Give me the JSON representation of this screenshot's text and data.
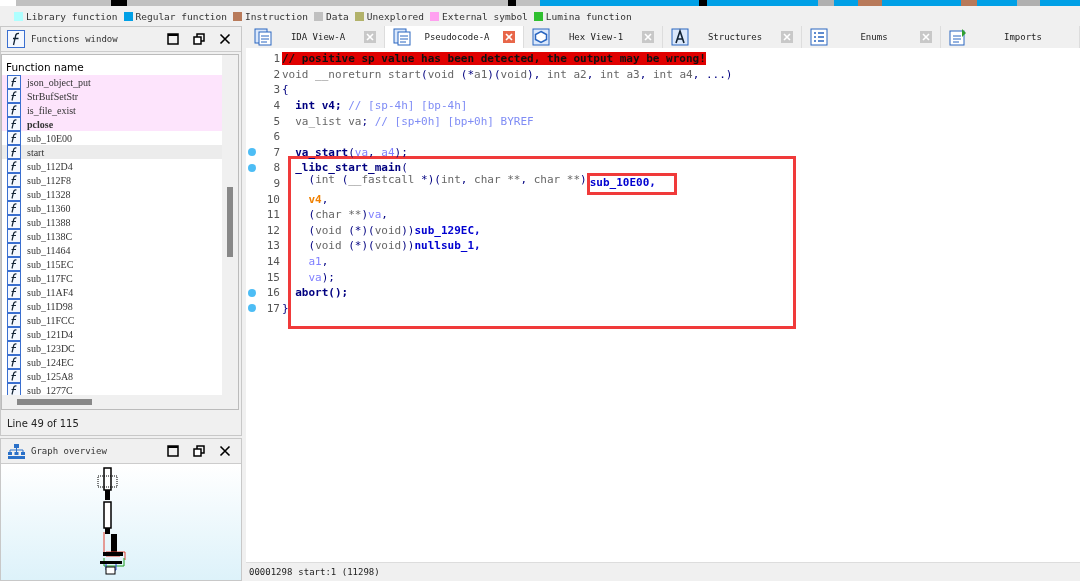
{
  "legend": [
    {
      "label": "Library function",
      "color": "#aeffff"
    },
    {
      "label": "Regular function",
      "color": "#00a0e6"
    },
    {
      "label": "Instruction",
      "color": "#b87a5a"
    },
    {
      "label": "Data",
      "color": "#c0c0c0"
    },
    {
      "label": "Unexplored",
      "color": "#b2b26a"
    },
    {
      "label": "External symbol",
      "color": "#ffa0f0"
    },
    {
      "label": "Lumina function",
      "color": "#30c030"
    }
  ],
  "functions_window": {
    "title": "Functions window",
    "column": "Function name",
    "items": [
      {
        "name": "json_object_put",
        "imported": true,
        "bold": false,
        "selected": false
      },
      {
        "name": "StrBufSetStr",
        "imported": true,
        "bold": false,
        "selected": false
      },
      {
        "name": "is_file_exist",
        "imported": true,
        "bold": false,
        "selected": false
      },
      {
        "name": "pclose",
        "imported": true,
        "bold": true,
        "selected": false
      },
      {
        "name": "sub_10E00",
        "imported": false,
        "bold": false,
        "selected": false
      },
      {
        "name": "start",
        "imported": false,
        "bold": false,
        "selected": true
      },
      {
        "name": "sub_112D4",
        "imported": false,
        "bold": false,
        "selected": false
      },
      {
        "name": "sub_112F8",
        "imported": false,
        "bold": false,
        "selected": false
      },
      {
        "name": "sub_11328",
        "imported": false,
        "bold": false,
        "selected": false
      },
      {
        "name": "sub_11360",
        "imported": false,
        "bold": false,
        "selected": false
      },
      {
        "name": "sub_11388",
        "imported": false,
        "bold": false,
        "selected": false
      },
      {
        "name": "sub_1138C",
        "imported": false,
        "bold": false,
        "selected": false
      },
      {
        "name": "sub_11464",
        "imported": false,
        "bold": false,
        "selected": false
      },
      {
        "name": "sub_115EC",
        "imported": false,
        "bold": false,
        "selected": false
      },
      {
        "name": "sub_117FC",
        "imported": false,
        "bold": false,
        "selected": false
      },
      {
        "name": "sub_11AF4",
        "imported": false,
        "bold": false,
        "selected": false
      },
      {
        "name": "sub_11D98",
        "imported": false,
        "bold": false,
        "selected": false
      },
      {
        "name": "sub_11FCC",
        "imported": false,
        "bold": false,
        "selected": false
      },
      {
        "name": "sub_121D4",
        "imported": false,
        "bold": false,
        "selected": false
      },
      {
        "name": "sub_123DC",
        "imported": false,
        "bold": false,
        "selected": false
      },
      {
        "name": "sub_124EC",
        "imported": false,
        "bold": false,
        "selected": false
      },
      {
        "name": "sub_125A8",
        "imported": false,
        "bold": false,
        "selected": false
      },
      {
        "name": "sub_1277C",
        "imported": false,
        "bold": false,
        "selected": false
      }
    ],
    "status": "Line 49 of 115"
  },
  "graph_overview": {
    "title": "Graph overview"
  },
  "tabs": [
    {
      "label": "IDA View-A",
      "selected": false
    },
    {
      "label": "Pseudocode-A",
      "selected": true
    },
    {
      "label": "Hex View-1",
      "selected": false
    },
    {
      "label": "Structures",
      "selected": false
    },
    {
      "label": "Enums",
      "selected": false
    },
    {
      "label": "Imports",
      "selected": false
    }
  ],
  "code": [
    {
      "number": "1",
      "breakpoint": false,
      "in_frame": false,
      "tokens": [
        {
          "text": "// positive sp value has been detected, the output may be wrong!",
          "kind": "warning"
        }
      ]
    },
    {
      "number": "2",
      "breakpoint": false,
      "in_frame": false,
      "tokens": [
        {
          "text": "void __noreturn start",
          "kind": "type"
        },
        {
          "text": "(",
          "kind": "punct"
        },
        {
          "text": "void ",
          "kind": "type"
        },
        {
          "text": "(*",
          "kind": "punct"
        },
        {
          "text": "a1",
          "kind": "type"
        },
        {
          "text": ")(",
          "kind": "punct"
        },
        {
          "text": "void",
          "kind": "type"
        },
        {
          "text": "), ",
          "kind": "punct"
        },
        {
          "text": "int a2",
          "kind": "type"
        },
        {
          "text": ", ",
          "kind": "punct"
        },
        {
          "text": "int a3",
          "kind": "type"
        },
        {
          "text": ", ",
          "kind": "punct"
        },
        {
          "text": "int a4",
          "kind": "type"
        },
        {
          "text": ", ...)",
          "kind": "punct"
        }
      ]
    },
    {
      "number": "3",
      "breakpoint": false,
      "in_frame": false,
      "tokens": [
        {
          "text": "{",
          "kind": "punct"
        }
      ]
    },
    {
      "number": "4",
      "breakpoint": false,
      "in_frame": false,
      "tokens": [
        {
          "text": "  int v4; ",
          "kind": "ident"
        },
        {
          "text": "// [sp-4h] [bp-4h]",
          "kind": "comment"
        }
      ]
    },
    {
      "number": "5",
      "breakpoint": false,
      "in_frame": false,
      "tokens": [
        {
          "text": "  va_list va",
          "kind": "type"
        },
        {
          "text": "; ",
          "kind": "punct"
        },
        {
          "text": "// [sp+0h] [bp+0h] BYREF",
          "kind": "comment"
        }
      ]
    },
    {
      "number": "6",
      "breakpoint": false,
      "in_frame": false
    },
    {
      "number": "7",
      "breakpoint": true,
      "in_frame": false,
      "tokens": [
        {
          "text": "  va_start",
          "kind": "ident"
        },
        {
          "text": "(",
          "kind": "punct"
        },
        {
          "text": "va",
          "kind": "var"
        },
        {
          "text": ", ",
          "kind": "punct"
        },
        {
          "text": "a4",
          "kind": "var"
        },
        {
          "text": ");",
          "kind": "punct"
        }
      ]
    },
    {
      "number": "8",
      "breakpoint": true,
      "in_frame": true,
      "tokens": [
        {
          "text": "  _libc_start_main",
          "kind": "ident"
        },
        {
          "text": "(",
          "kind": "punct"
        }
      ]
    },
    {
      "number": "9",
      "breakpoint": false,
      "in_frame": true,
      "tokens": [
        {
          "text": "    (",
          "kind": "punct"
        },
        {
          "text": "int ",
          "kind": "type"
        },
        {
          "text": "(",
          "kind": "punct"
        },
        {
          "text": "__fastcall ",
          "kind": "type"
        },
        {
          "text": "*)(",
          "kind": "punct"
        },
        {
          "text": "int",
          "kind": "type"
        },
        {
          "text": ", ",
          "kind": "punct"
        },
        {
          "text": "char **",
          "kind": "type"
        },
        {
          "text": ", ",
          "kind": "punct"
        },
        {
          "text": "char **",
          "kind": "type"
        },
        {
          "text": ")",
          "kind": "punct"
        },
        {
          "text": "sub_10E00,",
          "kind": "func",
          "framed": true
        }
      ]
    },
    {
      "number": "10",
      "breakpoint": false,
      "in_frame": true,
      "tokens": [
        {
          "text": "    v4",
          "kind": "local"
        },
        {
          "text": ",",
          "kind": "punct"
        }
      ]
    },
    {
      "number": "11",
      "breakpoint": false,
      "in_frame": true,
      "tokens": [
        {
          "text": "    (",
          "kind": "punct"
        },
        {
          "text": "char **",
          "kind": "type"
        },
        {
          "text": ")",
          "kind": "punct"
        },
        {
          "text": "va",
          "kind": "var"
        },
        {
          "text": ",",
          "kind": "punct"
        }
      ]
    },
    {
      "number": "12",
      "breakpoint": false,
      "in_frame": true,
      "tokens": [
        {
          "text": "    (",
          "kind": "punct"
        },
        {
          "text": "void ",
          "kind": "type"
        },
        {
          "text": "(*)(",
          "kind": "punct"
        },
        {
          "text": "void",
          "kind": "type"
        },
        {
          "text": "))",
          "kind": "punct"
        },
        {
          "text": "sub_129EC,",
          "kind": "func"
        }
      ]
    },
    {
      "number": "13",
      "breakpoint": false,
      "in_frame": true,
      "tokens": [
        {
          "text": "    (",
          "kind": "punct"
        },
        {
          "text": "void ",
          "kind": "type"
        },
        {
          "text": "(*)(",
          "kind": "punct"
        },
        {
          "text": "void",
          "kind": "type"
        },
        {
          "text": "))",
          "kind": "punct"
        },
        {
          "text": "nullsub_1,",
          "kind": "func"
        }
      ]
    },
    {
      "number": "14",
      "breakpoint": false,
      "in_frame": true,
      "tokens": [
        {
          "text": "    a1",
          "kind": "var"
        },
        {
          "text": ",",
          "kind": "punct"
        }
      ]
    },
    {
      "number": "15",
      "breakpoint": false,
      "in_frame": true,
      "tokens": [
        {
          "text": "    va",
          "kind": "var"
        },
        {
          "text": ");",
          "kind": "punct"
        }
      ]
    },
    {
      "number": "16",
      "breakpoint": true,
      "in_frame": true,
      "tokens": [
        {
          "text": "  abort();",
          "kind": "ident"
        }
      ]
    },
    {
      "number": "17",
      "breakpoint": true,
      "in_frame": true,
      "tokens": [
        {
          "text": "}",
          "kind": "punct"
        }
      ]
    }
  ],
  "status_bar": {
    "address": "00001298",
    "location": "start:1 (11298)"
  }
}
